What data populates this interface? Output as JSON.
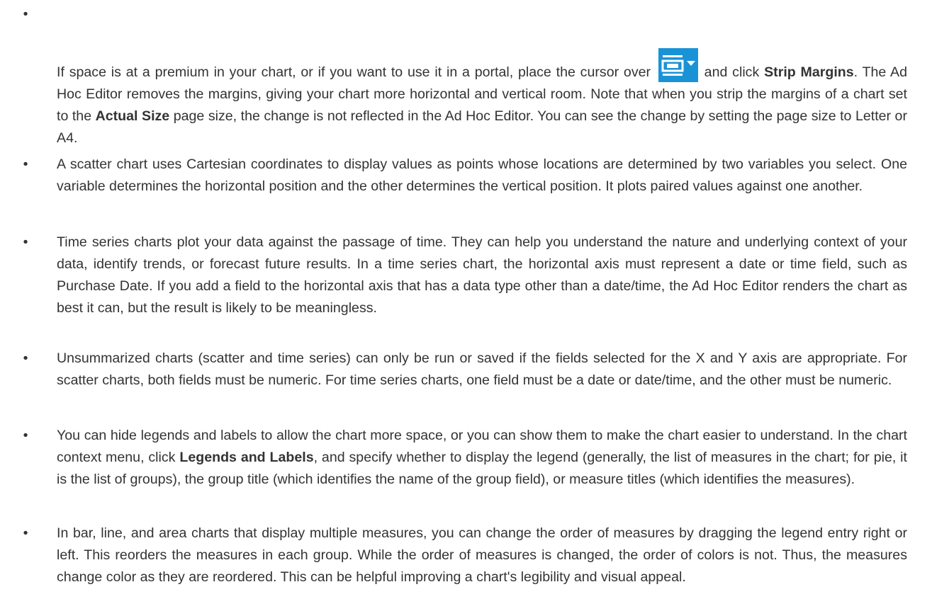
{
  "bullet_char": "•",
  "icon": {
    "name": "chart-options-menu-icon",
    "color": "#1a93d6"
  },
  "items": [
    {
      "pre_icon": "If space is at a premium in your chart, or if you want to use it in a portal, place the cursor over",
      "after_icon": "and click",
      "bold1": "Strip Margins",
      "mid1": ". The Ad Hoc Editor removes the margins, giving your chart more horizontal and vertical room. Note that when you strip the margins of a chart set to the",
      "bold2": "Actual Size",
      "end": "page size, the change is not reflected in the Ad Hoc Editor. You can see the change by setting the page size to Letter or A4."
    },
    {
      "text": "A scatter chart uses Cartesian coordinates to display values as points whose locations are determined by two variables you select. One variable determines the horizontal position and the other determines the vertical position. It plots paired values against one another."
    },
    {
      "text": "Time series charts plot your data against the passage of time. They can help you understand the nature and underlying context of your data, identify trends, or forecast future results. In a time series chart, the horizontal axis must represent a date or time field, such as Purchase Date. If you add a field to the horizontal axis that has a data type other than a date/time, the Ad Hoc Editor renders the chart as best it can, but the result is likely to be meaningless."
    },
    {
      "text": "Unsummarized charts (scatter and time series) can only be run or saved if the fields selected for the X and Y axis are appropriate. For scatter charts, both fields must be numeric. For time series charts, one field must be a date or date/time, and the other must be numeric."
    },
    {
      "pre": "You can hide legends and labels to allow the chart more space, or you can show them to make the chart easier to understand. In the chart context menu, click",
      "bold": "Legends and Labels",
      "post": ", and specify whether to display the legend (generally, the list of measures in the chart; for pie, it is the list of groups), the group title (which identifies the name of the group field), or measure titles (which identifies the measures)."
    },
    {
      "text": "In bar, line, and area charts that display multiple measures, you can change the order of measures by dragging the legend entry right or left. This reorders the measures in each group. While the order of measures is changed, the order of colors is not. Thus, the measures change color as they are reordered. This can be helpful improving a chart's legibility and visual appeal."
    }
  ]
}
